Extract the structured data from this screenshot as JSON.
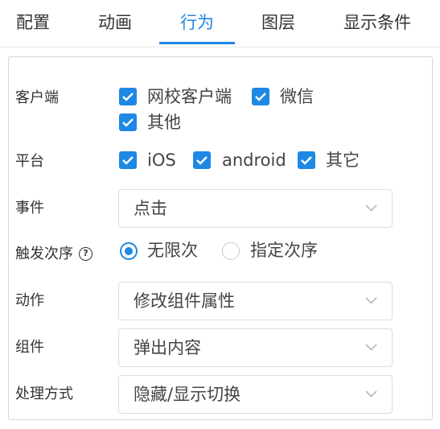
{
  "tabs": [
    {
      "label": "配置",
      "active": false
    },
    {
      "label": "动画",
      "active": false
    },
    {
      "label": "行为",
      "active": true
    },
    {
      "label": "图层",
      "active": false
    },
    {
      "label": "显示条件",
      "active": false
    }
  ],
  "form": {
    "client": {
      "label": "客户端",
      "options": [
        {
          "label": "网校客户端",
          "checked": true
        },
        {
          "label": "微信",
          "checked": true
        },
        {
          "label": "其他",
          "checked": true
        }
      ]
    },
    "platform": {
      "label": "平台",
      "options": [
        {
          "label": "iOS",
          "checked": true
        },
        {
          "label": "android",
          "checked": true
        },
        {
          "label": "其它",
          "checked": true
        }
      ]
    },
    "event": {
      "label": "事件",
      "value": "点击"
    },
    "trigger_order": {
      "label": "触发次序",
      "help_icon": "question-circle-icon",
      "options": [
        {
          "label": "无限次",
          "selected": true
        },
        {
          "label": "指定次序",
          "selected": false
        }
      ]
    },
    "action": {
      "label": "动作",
      "value": "修改组件属性"
    },
    "component": {
      "label": "组件",
      "value": "弹出内容"
    },
    "handling": {
      "label": "处理方式",
      "value": "隐藏/显示切换"
    }
  },
  "colors": {
    "accent": "#1e88e5",
    "border": "#dcdcdc",
    "text": "#333333"
  }
}
